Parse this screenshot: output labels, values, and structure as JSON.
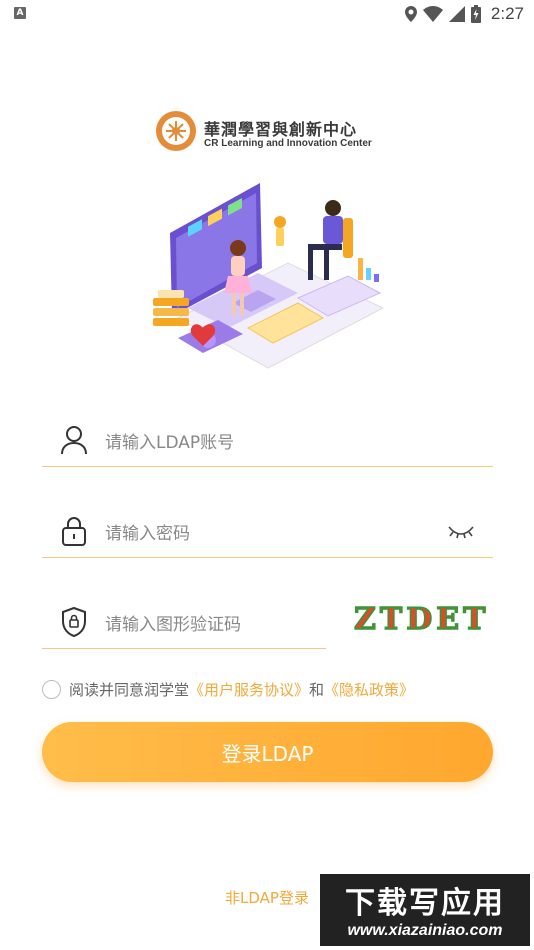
{
  "status_bar": {
    "notification_badge": "A",
    "time": "2:27",
    "icons": [
      "location-icon",
      "wifi-icon",
      "signal-icon",
      "battery-charging-icon"
    ]
  },
  "logo": {
    "title": "華潤學習與創新中心",
    "subtitle": "CR Learning and Innovation Center"
  },
  "form": {
    "account_placeholder": "请输入LDAP账号",
    "password_placeholder": "请输入密码",
    "captcha_placeholder": "请输入图形验证码",
    "captcha_text": "ZTDET"
  },
  "agreement": {
    "prefix": "阅读并同意润学堂",
    "user_agreement": "《用户服务协议》",
    "and": "和",
    "privacy_policy": "《隐私政策》"
  },
  "login_button": "登录LDAP",
  "non_ldap_link": "非LDAP登录",
  "watermark": {
    "title": "下载写应用",
    "url": "www.xiazainiao.com"
  },
  "colors": {
    "accent": "#f0a93a",
    "button_start": "#ffbd4a",
    "button_end": "#ffa72e",
    "field_underline": "#f5c97a"
  }
}
